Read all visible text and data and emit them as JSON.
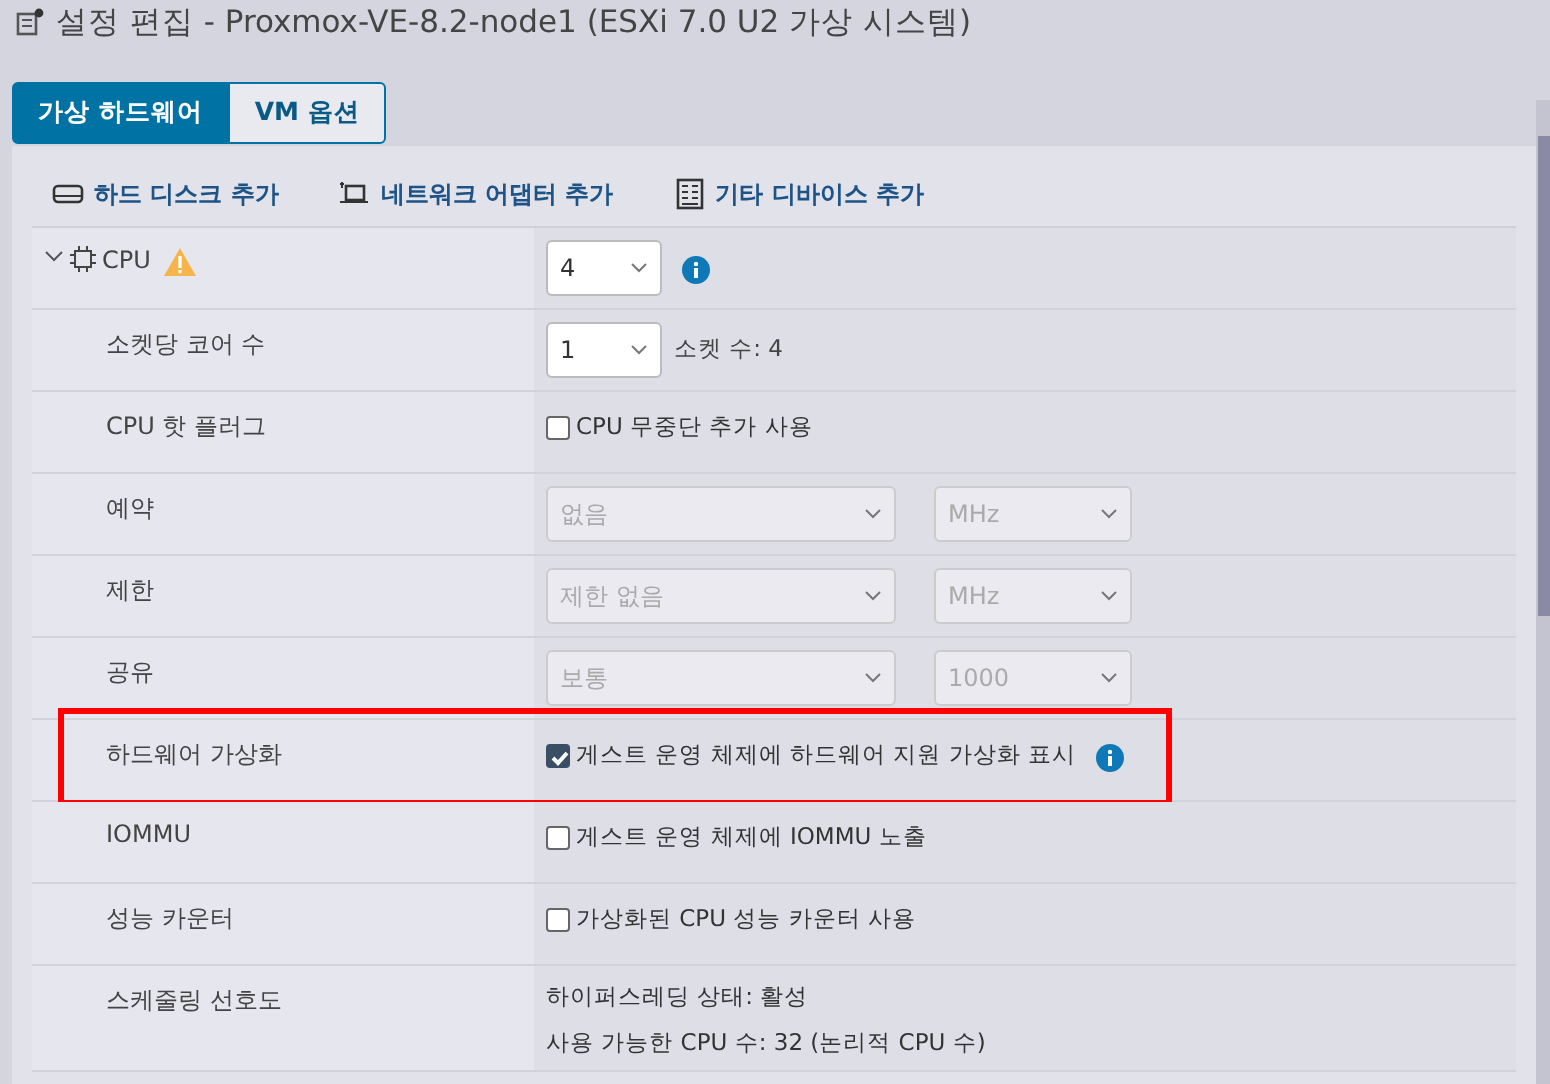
{
  "window": {
    "title": "설정 편집 - Proxmox-VE-8.2-node1 (ESXi 7.0 U2 가상 시스템)"
  },
  "tabs": [
    {
      "label": "가상 하드웨어",
      "selected": true
    },
    {
      "label": "VM 옵션",
      "selected": false
    }
  ],
  "toolbar": [
    {
      "label": "하드 디스크 추가",
      "kind": "disk"
    },
    {
      "label": "네트워크 어댑터 추가",
      "kind": "network"
    },
    {
      "label": "기타 디바이스 추가",
      "kind": "device"
    }
  ],
  "rows": [
    {
      "label": "CPU",
      "kind": "select",
      "value": "4",
      "info": true,
      "warning": true,
      "expanded": true,
      "children": [
        {
          "label": "소켓당 코어 수",
          "kind": "select",
          "value": "1",
          "note": "소켓 수: 4"
        },
        {
          "label": "CPU 핫 플러그",
          "kind": "checkbox",
          "checked": false,
          "text": "CPU 무중단 추가 사용"
        },
        {
          "label": "예약",
          "kind": "dual_select",
          "value": "없음",
          "unit": "MHz",
          "disabled": true
        },
        {
          "label": "제한",
          "kind": "dual_select",
          "value": "제한 없음",
          "unit": "MHz",
          "disabled": true
        },
        {
          "label": "공유",
          "kind": "dual_select",
          "value": "보통",
          "unit": "1000",
          "disabled": true
        },
        {
          "label": "하드웨어 가상화",
          "kind": "checkbox",
          "checked": true,
          "text": "게스트 운영 체제에 하드웨어 지원 가상화 표시",
          "info": true,
          "highlighted": true
        },
        {
          "label": "IOMMU",
          "kind": "checkbox",
          "checked": false,
          "text": "게스트 운영 체제에 IOMMU 노출"
        },
        {
          "label": "성능 카운터",
          "kind": "checkbox",
          "checked": false,
          "text": "가상화된 CPU 성능 카운터 사용"
        },
        {
          "label": "스케줄링 선호도",
          "kind": "lines",
          "lines": [
            "하이퍼스레딩 상태: 활성",
            "사용 가능한 CPU 수: 32 (논리적 CPU 수)"
          ]
        }
      ]
    }
  ]
}
